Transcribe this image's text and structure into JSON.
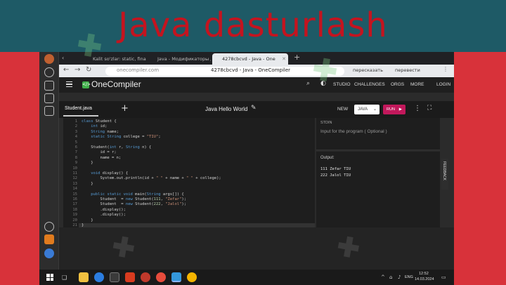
{
  "banner": {
    "title": "Java dasturlash"
  },
  "browser": {
    "tabs": [
      {
        "label": "Kalit so'zlar: static, final, yo",
        "favicon_color": "#e8453c"
      },
      {
        "label": "Java - Модификаторы до...",
        "favicon_color": "#2a5db0"
      },
      {
        "label": "4278cbcvd - Java - One",
        "favicon_color": "#3a6fd8"
      }
    ],
    "address": {
      "host": "onecompiler.com",
      "page_title": "4278cbcvd - Java - OneCompiler"
    },
    "actions": {
      "translate_short": "пересказать",
      "translate": "перевести"
    }
  },
  "onecompiler": {
    "brand": "OneCompiler",
    "nav": [
      "STUDIO",
      "CHALLENGES",
      "ORGS",
      "MORE",
      "LOGIN"
    ]
  },
  "editor_bar": {
    "file_tab": "Student.java",
    "project_title": "Java Hello World",
    "new_label": "NEW",
    "language": "JAVA",
    "run_label": "RUN"
  },
  "code": {
    "line_numbers": [
      "1",
      "2",
      "3",
      "4",
      "5",
      "6",
      "7",
      "8",
      "9",
      "10",
      "11",
      "12",
      "13",
      "14",
      "15",
      "16",
      "17",
      "18",
      "19",
      "20",
      "21",
      "22"
    ],
    "lines": [
      "class Student {",
      "    int id;",
      "    String name;",
      "    static String college = \"TIU\";",
      "",
      "    Student(int r, String n) {",
      "        id = r;",
      "        name = n;",
      "    }",
      "",
      "    void display() {",
      "        System.out.println(id + \" \" + name + \" \" + college);",
      "    }",
      "",
      "    public static void main(String args[]) {",
      "        Student s1 = new Student(111, \"Zefar\");",
      "        Student s2 = new Student(222, \"Jalol\");",
      "        s1.display();",
      "        s2.display();",
      "    }",
      "}",
      ""
    ],
    "current_line": 21
  },
  "stdin": {
    "label": "STDIN",
    "placeholder": "Input for the program ( Optional )"
  },
  "output": {
    "label": "Output:",
    "lines": [
      "111 Zefar TIU",
      "222 Jalol TIU"
    ]
  },
  "feedback_tab": "FEEDBACK",
  "taskbar": {
    "lang": "ENG",
    "time": "12:52",
    "date": "14.03.2024"
  },
  "colors": {
    "banner_bg": "#1e5a66",
    "banner_title": "#c4141f",
    "side_red": "#d8323a",
    "run_button": "#c2185b"
  }
}
